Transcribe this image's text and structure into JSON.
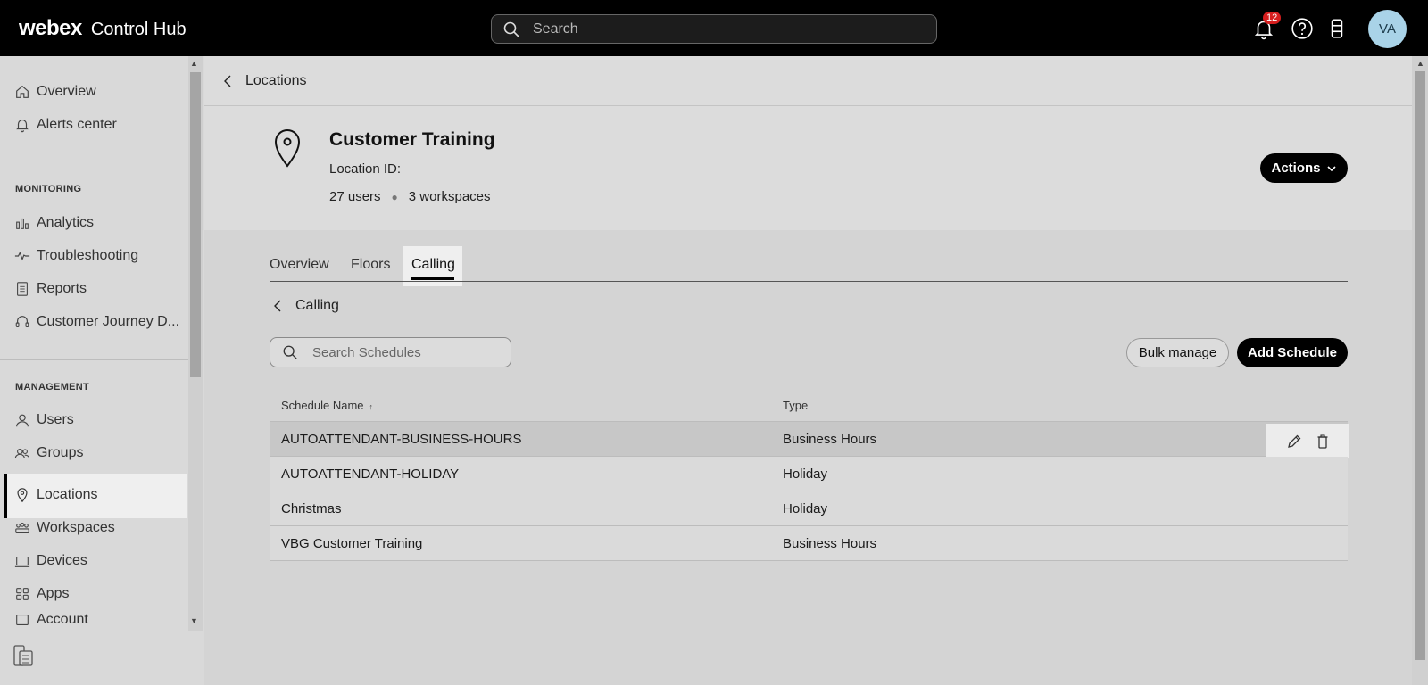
{
  "topbar": {
    "brand": "webex",
    "product": "Control Hub",
    "search_placeholder": "Search",
    "notification_count": "12",
    "avatar_initials": "VA"
  },
  "sidebar": {
    "items_top": [
      {
        "label": "Overview",
        "icon": "home-icon"
      },
      {
        "label": "Alerts center",
        "icon": "bell-icon"
      }
    ],
    "monitoring_label": "MONITORING",
    "monitoring_items": [
      {
        "label": "Analytics",
        "icon": "bar-chart-icon"
      },
      {
        "label": "Troubleshooting",
        "icon": "pulse-icon"
      },
      {
        "label": "Reports",
        "icon": "document-icon"
      },
      {
        "label": "Customer Journey D...",
        "icon": "headset-icon"
      }
    ],
    "management_label": "MANAGEMENT",
    "management_items": [
      {
        "label": "Users",
        "icon": "user-icon"
      },
      {
        "label": "Groups",
        "icon": "group-icon"
      },
      {
        "label": "Locations",
        "icon": "location-pin-icon"
      },
      {
        "label": "Workspaces",
        "icon": "workspaces-icon"
      },
      {
        "label": "Devices",
        "icon": "device-icon"
      },
      {
        "label": "Apps",
        "icon": "apps-grid-icon"
      },
      {
        "label": "Account",
        "icon": "account-icon"
      }
    ],
    "active_item": "Locations"
  },
  "main": {
    "breadcrumb": "Locations",
    "location_name": "Customer Training",
    "location_id_label": "Location ID:",
    "users_count": "27 users",
    "workspaces_count": "3 workspaces",
    "actions_label": "Actions",
    "tabs": [
      {
        "label": "Overview"
      },
      {
        "label": "Floors"
      },
      {
        "label": "Calling"
      }
    ],
    "active_tab": "Calling",
    "sub_breadcrumb": "Calling",
    "schedule_search_placeholder": "Search Schedules",
    "bulk_manage_label": "Bulk manage",
    "add_schedule_label": "Add Schedule",
    "table": {
      "columns": [
        "Schedule Name",
        "Type"
      ],
      "rows": [
        {
          "name": "AUTOATTENDANT-BUSINESS-HOURS",
          "type": "Business Hours"
        },
        {
          "name": "AUTOATTENDANT-HOLIDAY",
          "type": "Holiday"
        },
        {
          "name": "Christmas",
          "type": "Holiday"
        },
        {
          "name": "VBG Customer Training",
          "type": "Business Hours"
        }
      ]
    }
  }
}
